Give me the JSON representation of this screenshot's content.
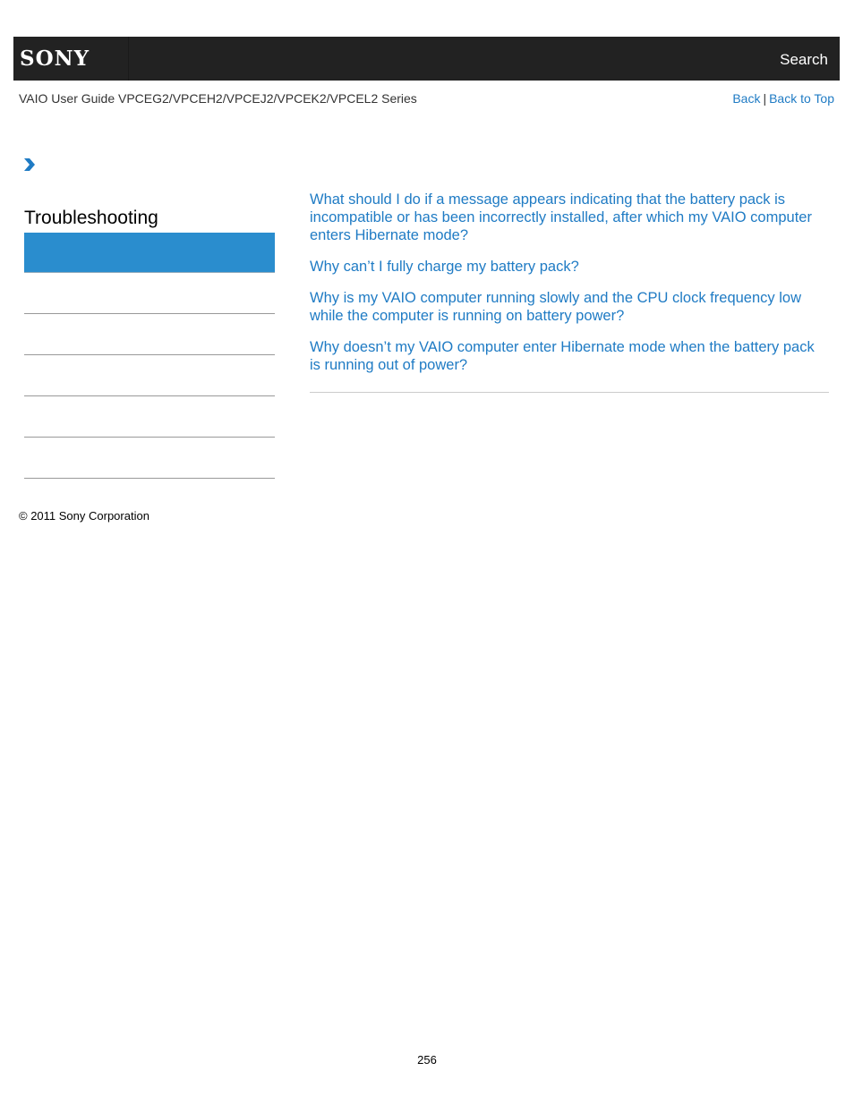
{
  "header": {
    "logo": "SONY",
    "search_label": "Search"
  },
  "subheader": {
    "guide_title": "VAIO User Guide VPCEG2/VPCEH2/VPCEJ2/VPCEK2/VPCEL2 Series",
    "back_label": "Back",
    "separator": "|",
    "back_to_top_label": "Back to Top"
  },
  "breadcrumb": {
    "icon": "chevron-right-icon"
  },
  "sidebar": {
    "title": "Troubleshooting",
    "items": [
      {
        "label": "",
        "active": true
      },
      {
        "label": "",
        "active": false
      },
      {
        "label": "",
        "active": false
      },
      {
        "label": "",
        "active": false
      },
      {
        "label": "",
        "active": false
      },
      {
        "label": "",
        "active": false
      }
    ]
  },
  "main": {
    "links": [
      "What should I do if a message appears indicating that the battery pack is incompatible or has been incorrectly installed, after which my VAIO computer enters Hibernate mode?",
      "Why can’t I fully charge my battery pack?",
      "Why is my VAIO computer running slowly and the CPU clock frequency low while the computer is running on battery power?",
      "Why doesn’t my VAIO computer enter Hibernate mode when the battery pack is running out of power?"
    ]
  },
  "footer": {
    "copyright": "© 2011 Sony Corporation",
    "page_number": "256"
  },
  "colors": {
    "header_bg": "#222222",
    "link": "#1f7bc4",
    "active_item": "#2a8dce"
  }
}
